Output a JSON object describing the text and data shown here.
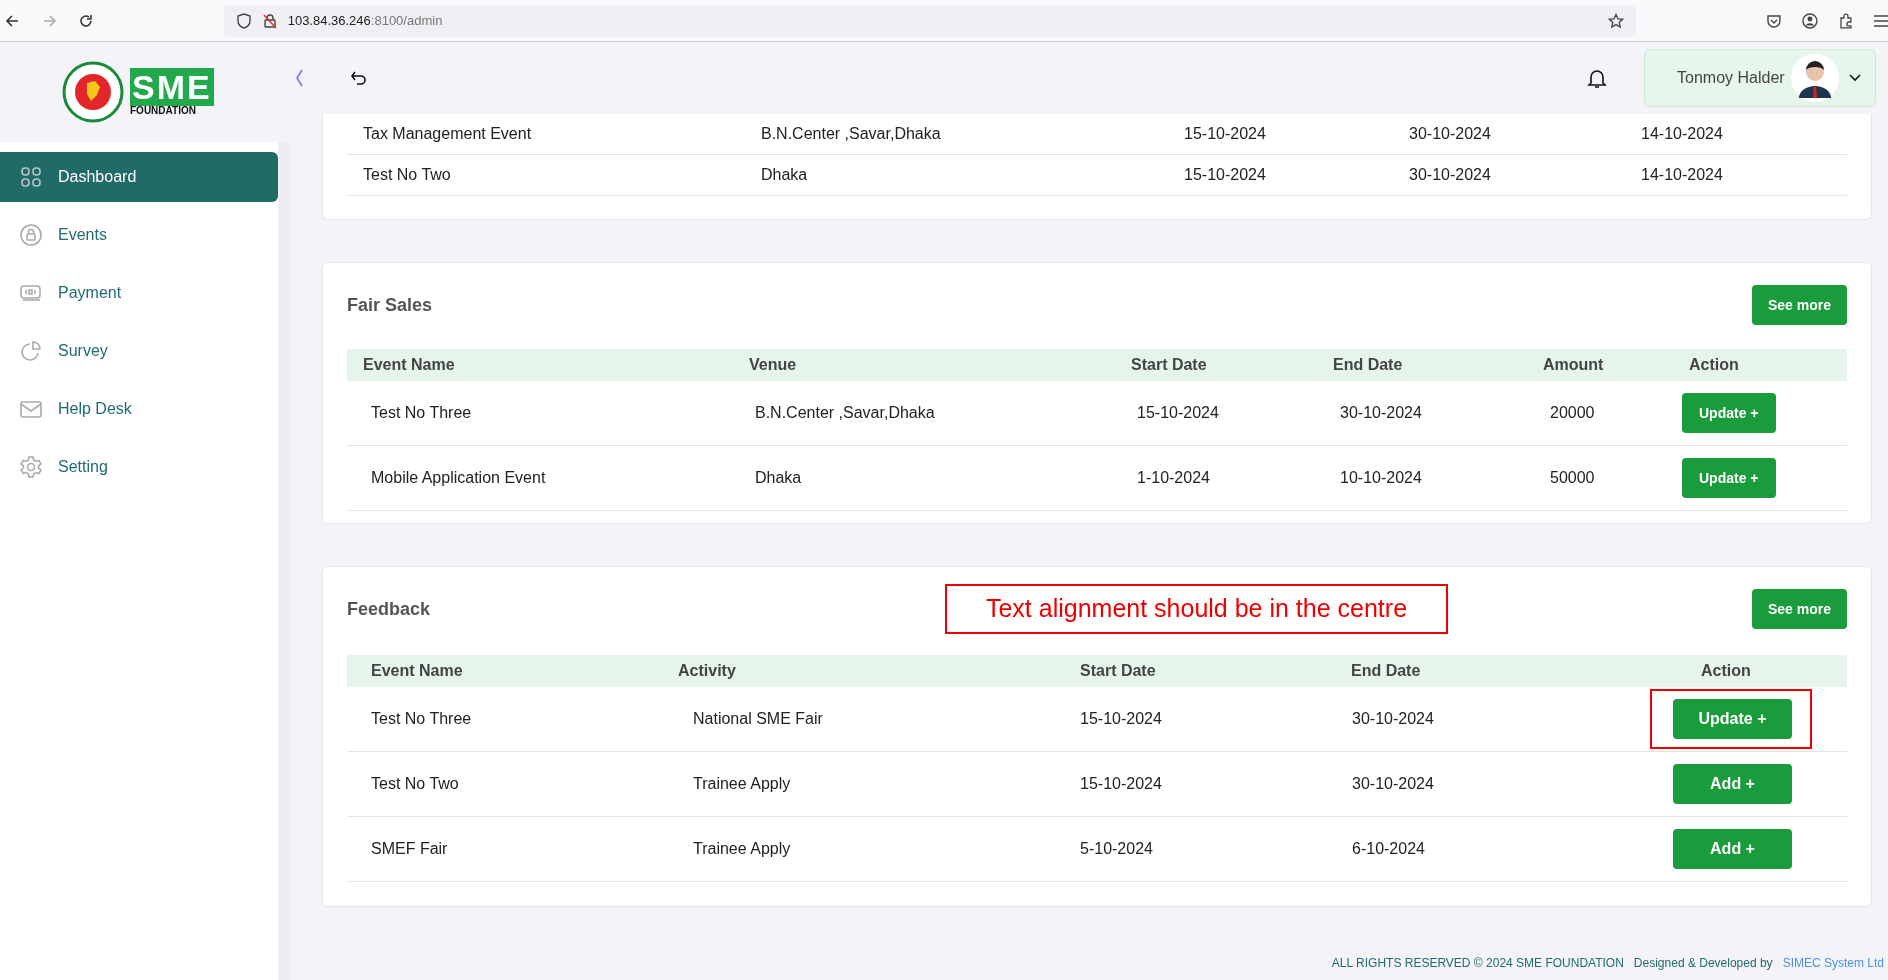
{
  "browser": {
    "url_host": "103.84.36.246",
    "url_rest": ":8100/admin"
  },
  "logo": {
    "text": "SME",
    "subtitle": "FOUNDATION"
  },
  "user": {
    "name": "Tonmoy Halder"
  },
  "sidebar": {
    "items": [
      {
        "label": "Dashboard",
        "selected": true
      },
      {
        "label": "Events",
        "selected": false
      },
      {
        "label": "Payment",
        "selected": false
      },
      {
        "label": "Survey",
        "selected": false
      },
      {
        "label": "Help Desk",
        "selected": false
      },
      {
        "label": "Setting",
        "selected": false
      }
    ]
  },
  "top_table": {
    "rows": [
      [
        "Tax Management Event",
        "B.N.Center ,Savar,Dhaka",
        "15-10-2024",
        "30-10-2024",
        "14-10-2024"
      ],
      [
        "Test No Two",
        "Dhaka",
        "15-10-2024",
        "30-10-2024",
        "14-10-2024"
      ]
    ]
  },
  "fair_sales": {
    "title": "Fair Sales",
    "see_more": "See more",
    "columns": [
      "Event Name",
      "Venue",
      "Start Date",
      "End Date",
      "Amount",
      "Action"
    ],
    "rows": [
      {
        "cells": [
          "Test No Three",
          "B.N.Center ,Savar,Dhaka",
          "15-10-2024",
          "30-10-2024",
          "20000"
        ],
        "action": "Update +"
      },
      {
        "cells": [
          "Mobile Application Event",
          "Dhaka",
          "1-10-2024",
          "10-10-2024",
          "50000"
        ],
        "action": "Update +"
      }
    ]
  },
  "feedback": {
    "title": "Feedback",
    "see_more": "See more",
    "annotation": "Text alignment should be in the centre",
    "columns": [
      "Event Name",
      "Activity",
      "Start Date",
      "End Date",
      "Action"
    ],
    "rows": [
      {
        "cells": [
          "Test No Three",
          "National SME Fair",
          "15-10-2024",
          "30-10-2024"
        ],
        "action": "Update +",
        "highlighted": true
      },
      {
        "cells": [
          "Test No Two",
          "Trainee Apply",
          "15-10-2024",
          "30-10-2024"
        ],
        "action": "Add +",
        "highlighted": false
      },
      {
        "cells": [
          "SMEF Fair",
          "Trainee Apply",
          "5-10-2024",
          "6-10-2024"
        ],
        "action": "Add +",
        "highlighted": false
      }
    ]
  },
  "footer": {
    "text": "ALL RIGHTS RESERVED © 2024 SME FOUNDATION   Designed & Developed by",
    "link": "SIMEC System Ltd"
  }
}
